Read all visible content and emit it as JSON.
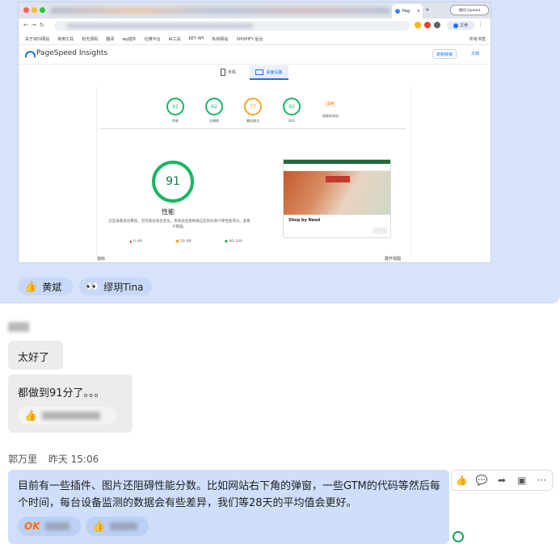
{
  "browser": {
    "tab_title": "Pag",
    "tab_close": "×",
    "new_tab": "+",
    "gemini": "询问 Gemini",
    "work": "工作",
    "bookmarks": [
      "关于SEO网站",
      "常用工具",
      "有无源码",
      "翻译",
      "wp插件",
      "社媒平台",
      "AI工具",
      "KEY API",
      "B2B网站",
      "SHOPIFY 后台"
    ],
    "all_bookmarks": "所有书签"
  },
  "psi": {
    "title": "PageSpeed Insights",
    "copy_link": "复制链接",
    "docs": "文档",
    "tabs": {
      "mobile": "手机",
      "desktop": "桌面设备"
    },
    "scores": [
      {
        "value": "91",
        "label": "性能",
        "color": "#18b663"
      },
      {
        "value": "92",
        "label": "无障碍",
        "color": "#18b663"
      },
      {
        "value": "77",
        "label": "最佳做法",
        "color": "#f5a623"
      },
      {
        "value": "92",
        "label": "SEO",
        "color": "#18b663"
      }
    ],
    "pwa": "2/4",
    "pwa_label": "智能体浏览",
    "big_score": "91",
    "big_label": "性能",
    "desc": "这些值都是估算值，且可能会发生变化。系统会直接根据这些指标来计算性能得分。查看计算器。",
    "legend": [
      "0–49",
      "50–89",
      "90–100"
    ],
    "shop_by_need": "Shop by Need",
    "bottom_left": "指标",
    "bottom_right": "展开视图"
  },
  "reactions_top": [
    {
      "emoji": "👍",
      "name": "黄斌"
    },
    {
      "emoji": "👀",
      "name": "缪玥Tina"
    }
  ],
  "msg2": "太好了",
  "msg3": "都做到91分了。。。",
  "msg4_author": "郭万里",
  "msg4_time": "昨天 15:06",
  "msg4": "目前有一些插件、图片还阻碍性能分数。比如网站右下角的弹窗，一些GTM的代码等然后每个时间，每台设备监测的数据会有些差异，我们等28天的平均值会更好。",
  "reaction_ok": "OK",
  "toolbar_icons": [
    "thumbs-up-icon",
    "comment-icon",
    "forward-icon",
    "pin-icon",
    "more-icon"
  ]
}
